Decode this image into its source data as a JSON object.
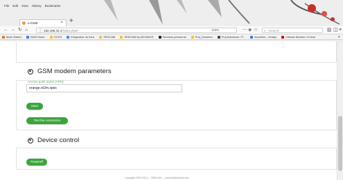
{
  "browser": {
    "menu": [
      "File",
      "Edit",
      "View",
      "History",
      "Bookmarks"
    ],
    "tab_title": "e-GSM",
    "url_base": "192.168.42.1",
    "url_path": "/index.php#",
    "zoom": "110%",
    "search_placeholder": "Search",
    "bookmarks": [
      {
        "label": "Most Visited",
        "color": "#e07a2a"
      },
      {
        "label": "NUM Home",
        "color": "#3a7bd5"
      },
      {
        "label": "GCDS",
        "color": "#f1c232"
      },
      {
        "label": "Intégrateur du futur",
        "color": "#4a86e8"
      },
      {
        "label": "SEDCAM",
        "color": "#f1c232"
      },
      {
        "label": "SEDCAM by ADVANCE",
        "color": "#f1c232"
      },
      {
        "label": "Services personnel",
        "color": "#222222"
      },
      {
        "label": "Proj_Dossiers",
        "color": "#f1c232"
      },
      {
        "label": "Proj Advances / P...",
        "color": "#444444"
      },
      {
        "label": "Imprimés - Verdys",
        "color": "#3a7bd5"
      },
      {
        "label": "Cellular Modem LH-less",
        "color": "#cc0000"
      }
    ]
  },
  "gsm": {
    "title": "GSM modem parameters",
    "apn_label": "Access point name (APN):",
    "apn_value": "orange.m2m.spec",
    "save_label": "Save",
    "test_label": "Test the connection"
  },
  "device": {
    "title": "Device control",
    "poweroff_label": "Poweroff"
  },
  "colors": {
    "accent_green": "#3aa63a",
    "label_green": "#4caf50"
  },
  "footer": "Copyright 2009-2013 — SEDCAM — contact@sedcam.com"
}
